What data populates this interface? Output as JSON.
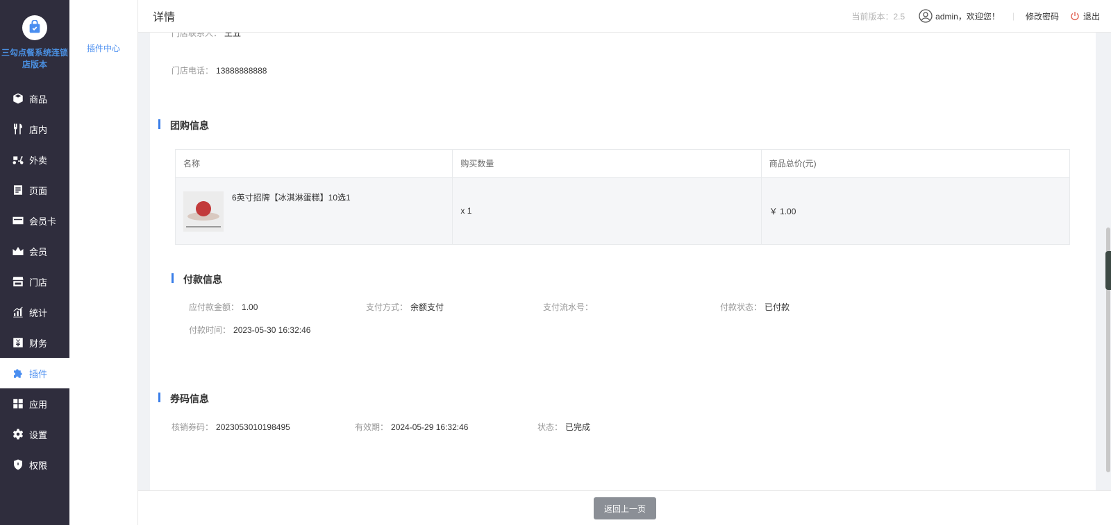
{
  "brand": {
    "name": "三勾点餐系统连锁店版本"
  },
  "sidebar": {
    "items": [
      {
        "label": "商品",
        "icon": "box-icon"
      },
      {
        "label": "店内",
        "icon": "fork-knife-icon"
      },
      {
        "label": "外卖",
        "icon": "scooter-icon"
      },
      {
        "label": "页面",
        "icon": "page-icon"
      },
      {
        "label": "会员卡",
        "icon": "card-icon"
      },
      {
        "label": "会员",
        "icon": "crown-icon"
      },
      {
        "label": "门店",
        "icon": "store-icon"
      },
      {
        "label": "统计",
        "icon": "chart-icon"
      },
      {
        "label": "财务",
        "icon": "yuan-icon"
      },
      {
        "label": "插件",
        "icon": "puzzle-icon",
        "active": true
      },
      {
        "label": "应用",
        "icon": "apps-icon"
      },
      {
        "label": "设置",
        "icon": "gear-icon"
      },
      {
        "label": "权限",
        "icon": "shield-icon"
      }
    ]
  },
  "submenu": {
    "item": "插件中心"
  },
  "header": {
    "title": "详情",
    "version": "当前版本：2.5",
    "user": "admin，欢迎您！",
    "divider": "|",
    "change_password": "修改密码",
    "logout": "退出"
  },
  "store": {
    "contact_label": "门店联系人：",
    "contact_value": "王五",
    "phone_label": "门店电话：",
    "phone_value": "13888888888"
  },
  "group_buy": {
    "title": "团购信息",
    "columns": [
      "名称",
      "购买数量",
      "商品总价(元)"
    ],
    "rows": [
      {
        "name": "6英寸招牌【冰淇淋蛋糕】10选1",
        "quantity": "x 1",
        "total": "￥ 1.00"
      }
    ]
  },
  "payment": {
    "title": "付款信息",
    "amount_label": "应付款金额：",
    "amount_value": "1.00",
    "method_label": "支付方式：",
    "method_value": "余额支付",
    "serial_label": "支付流水号：",
    "serial_value": "",
    "status_label": "付款状态：",
    "status_value": "已付款",
    "time_label": "付款时间：",
    "time_value": "2023-05-30 16:32:46"
  },
  "coupon": {
    "title": "券码信息",
    "code_label": "核销券码：",
    "code_value": "2023053010198495",
    "expiry_label": "有效期：",
    "expiry_value": "2024-05-29 16:32:46",
    "status_label": "状态：",
    "status_value": "已完成"
  },
  "footer": {
    "back_label": "返回上一页"
  },
  "colors": {
    "sidebar_bg": "#2f2d3d",
    "accent": "#4a8ef0",
    "button_gray": "#8b8f96"
  }
}
